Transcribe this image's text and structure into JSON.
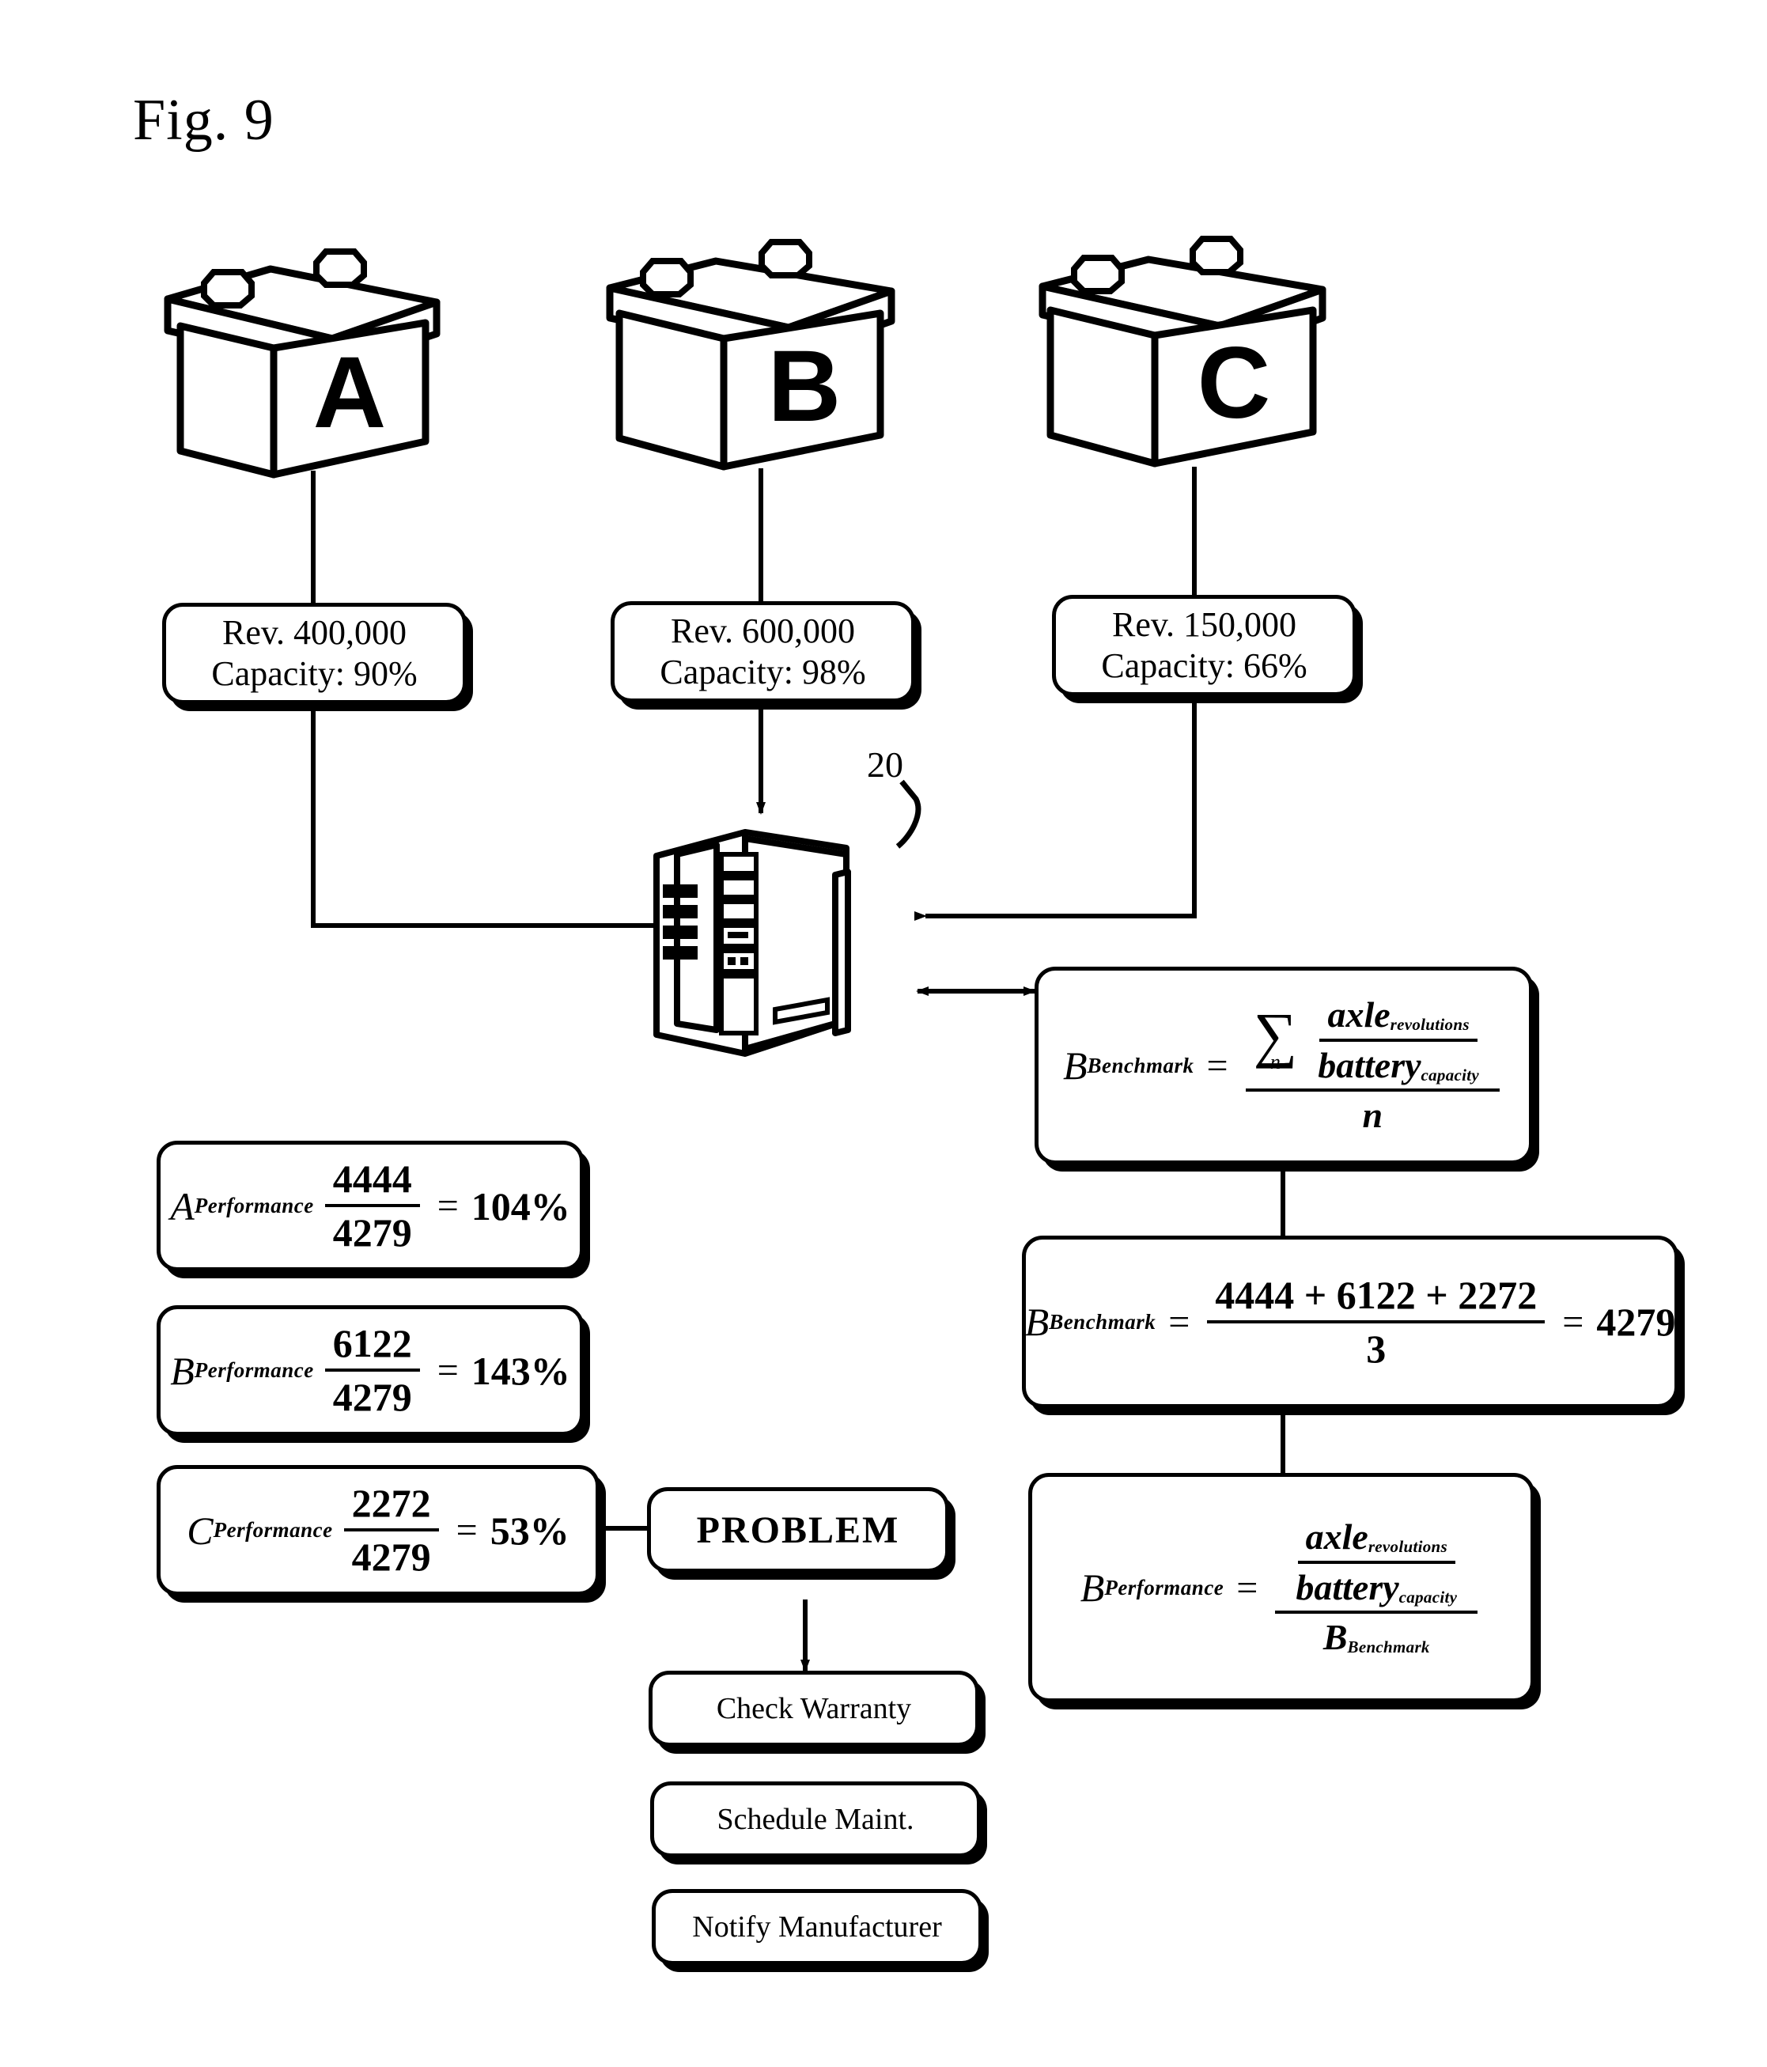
{
  "figure": {
    "label": "Fig. 9",
    "reference_numeral": "20"
  },
  "batteries": [
    {
      "letter": "A",
      "name": "battery-a"
    },
    {
      "letter": "B",
      "name": "battery-b"
    },
    {
      "letter": "C",
      "name": "battery-c"
    }
  ],
  "battery_readings": [
    {
      "revolutions": "Rev. 400,000",
      "capacity": "Capacity: 90%"
    },
    {
      "revolutions": "Rev. 600,000",
      "capacity": "Capacity: 98%"
    },
    {
      "revolutions": "Rev. 150,000",
      "capacity": "Capacity: 66%"
    }
  ],
  "formulas": {
    "benchmark_general": {
      "lhs_var": "B",
      "lhs_sub": "Benchmark",
      "equals": "=",
      "sigma": "∑",
      "sigma_index": "n",
      "inner_num_base": "axle",
      "inner_num_sub": "revolutions",
      "inner_den_base": "battery",
      "inner_den_sub": "capacity",
      "outer_den": "n"
    },
    "benchmark_numeric": {
      "lhs_var": "B",
      "lhs_sub": "Benchmark",
      "equals": "=",
      "numerator": "4444 + 6122 + 2272",
      "denominator": "3",
      "result_equals": "=",
      "result": "4279"
    },
    "performance_general": {
      "lhs_var": "B",
      "lhs_sub": "Performance",
      "equals": "=",
      "inner_num_base": "axle",
      "inner_num_sub": "revolutions",
      "inner_den_base": "battery",
      "inner_den_sub": "capacity",
      "outer_den_base": "B",
      "outer_den_sub": "Benchmark"
    }
  },
  "performance_results": [
    {
      "var": "A",
      "sub": "Performance",
      "numerator": "4444",
      "denominator": "4279",
      "equals": "=",
      "result": "104%"
    },
    {
      "var": "B",
      "sub": "Performance",
      "numerator": "6122",
      "denominator": "4279",
      "equals": "=",
      "result": "143%"
    },
    {
      "var": "C",
      "sub": "Performance",
      "numerator": "2272",
      "denominator": "4279",
      "equals": "=",
      "result": "53%"
    }
  ],
  "problem": {
    "label": "PROBLEM"
  },
  "actions": [
    {
      "label": "Check Warranty"
    },
    {
      "label": "Schedule Maint."
    },
    {
      "label": "Notify Manufacturer"
    }
  ],
  "colors": {
    "ink": "#000000",
    "paper": "#ffffff"
  }
}
